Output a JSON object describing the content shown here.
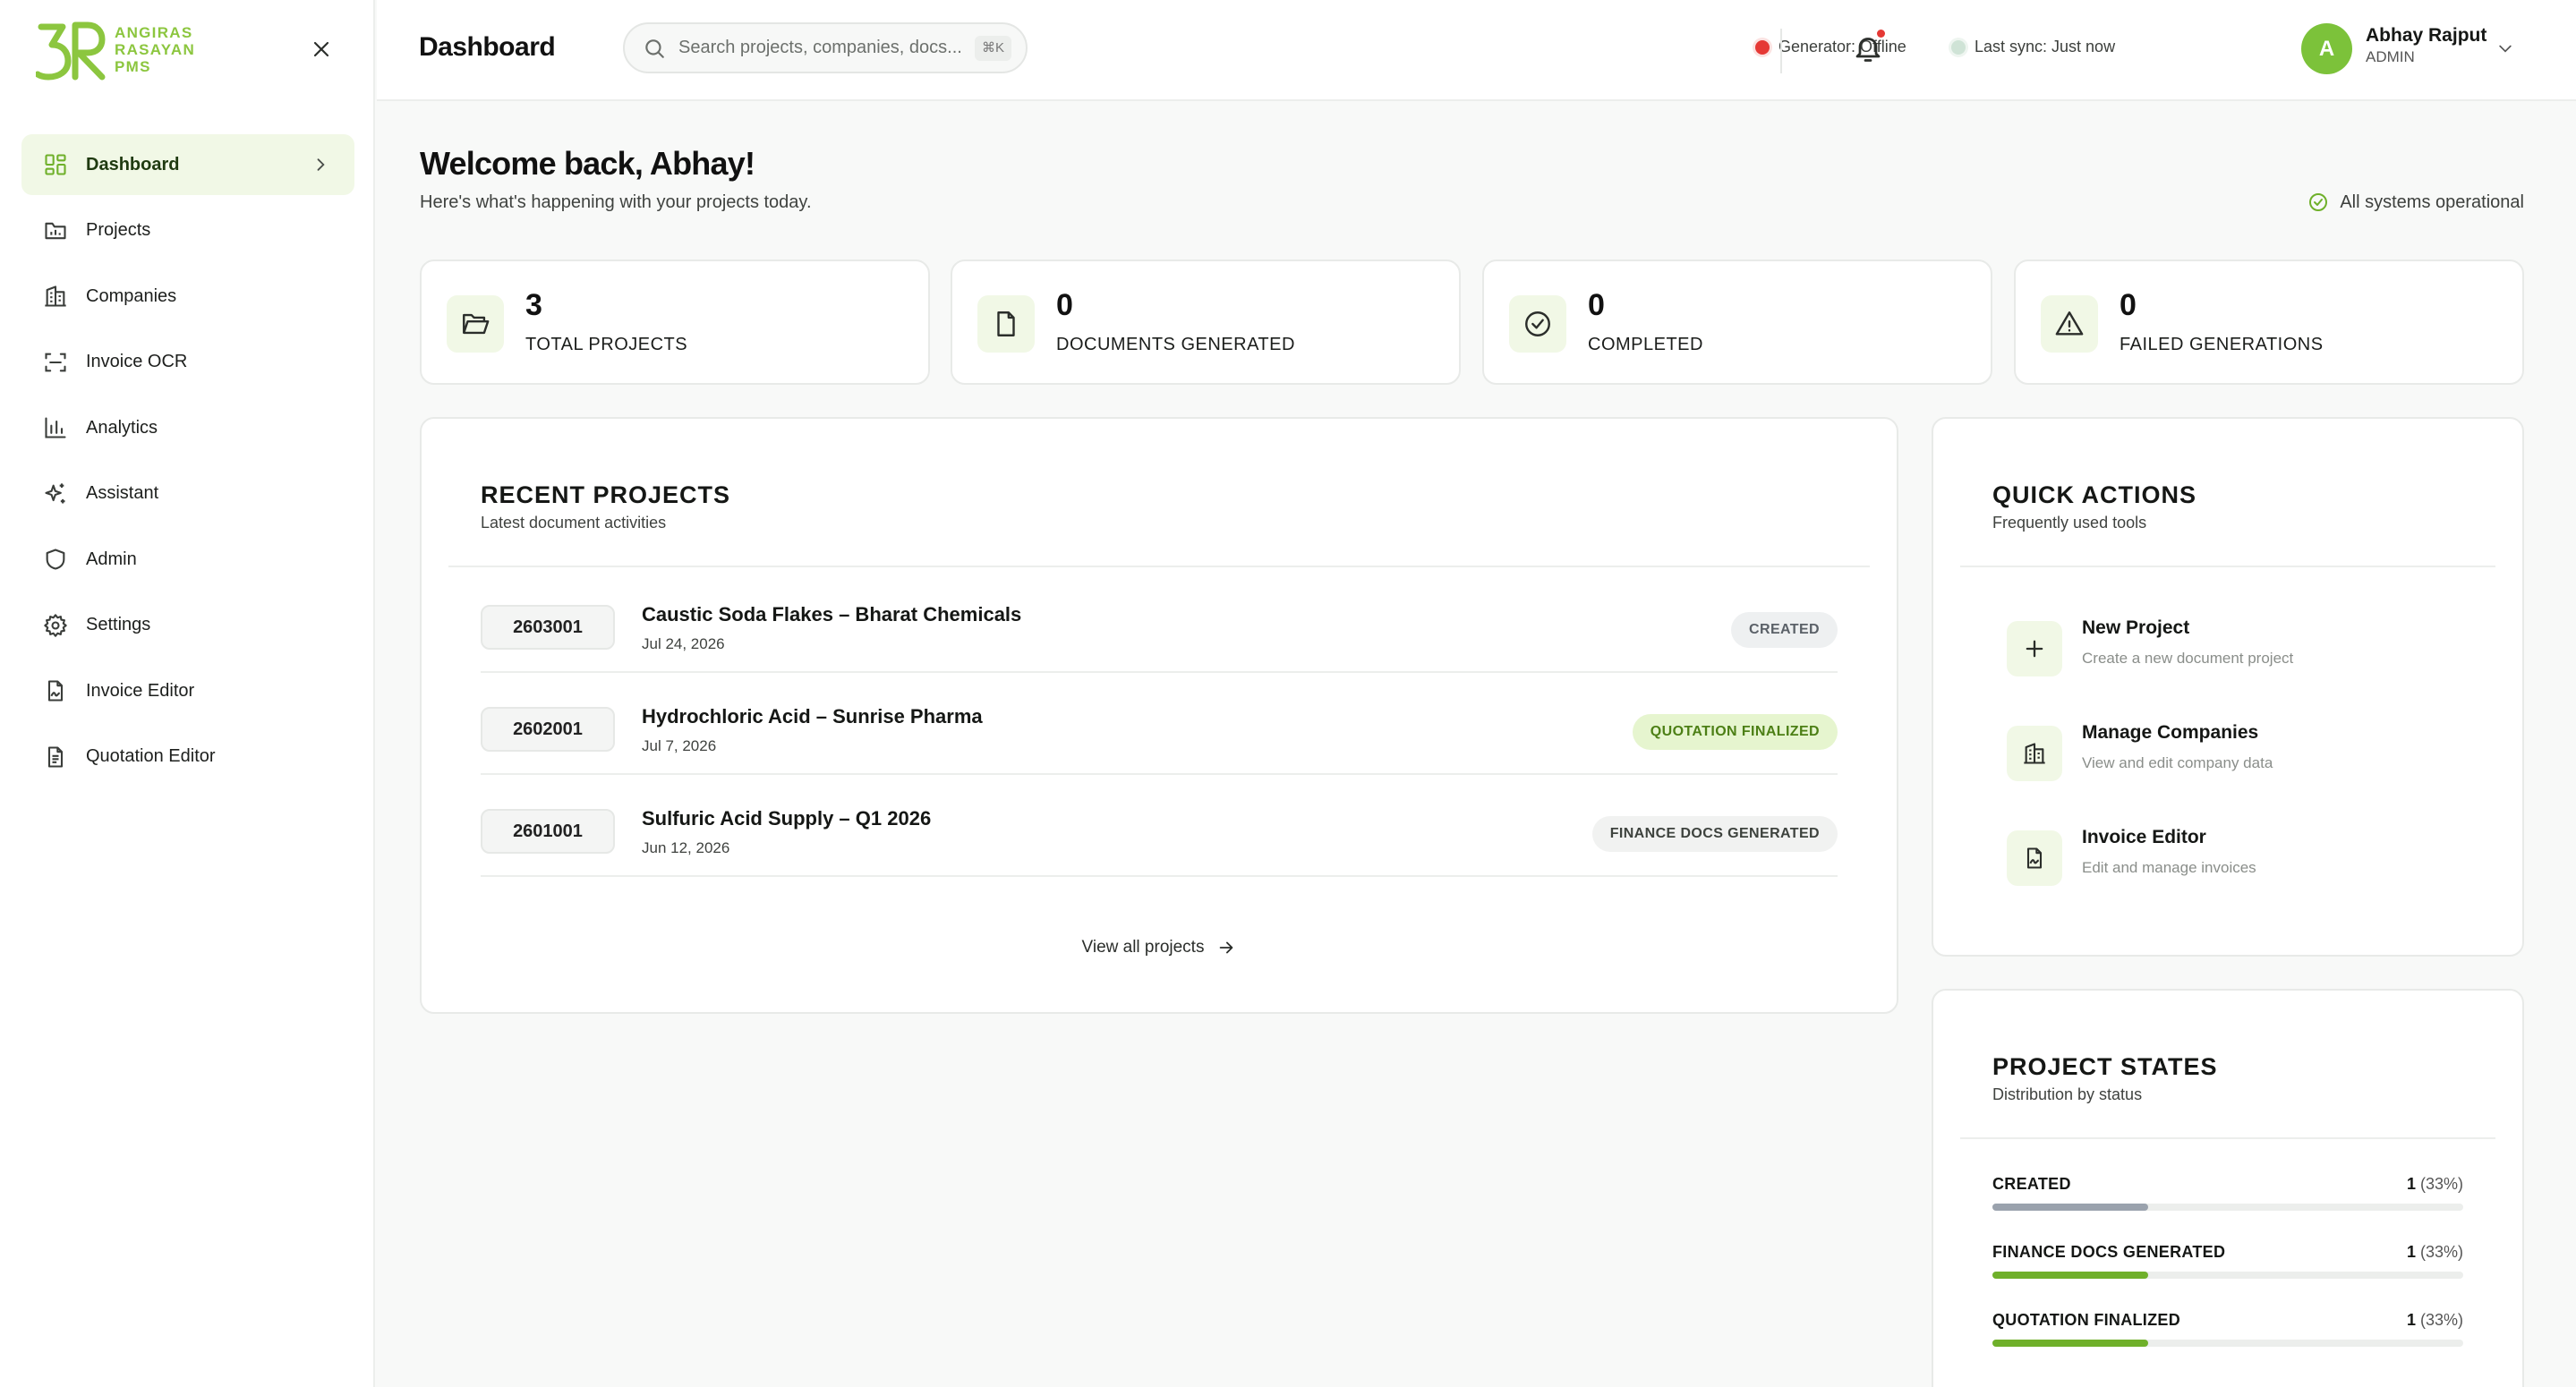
{
  "brand": {
    "logo_lines": [
      "ANGIRAS",
      "RASAYAN",
      "PMS"
    ],
    "accent": "#8cc63f"
  },
  "sidebar": {
    "items": [
      {
        "label": "Dashboard",
        "icon": "dashboard-icon",
        "active": true
      },
      {
        "label": "Projects",
        "icon": "folder-chart-icon"
      },
      {
        "label": "Companies",
        "icon": "building-icon"
      },
      {
        "label": "Invoice OCR",
        "icon": "scan-icon"
      },
      {
        "label": "Analytics",
        "icon": "bar-chart-icon"
      },
      {
        "label": "Assistant",
        "icon": "sparkles-icon"
      },
      {
        "label": "Admin",
        "icon": "shield-icon"
      },
      {
        "label": "Settings",
        "icon": "gear-icon"
      },
      {
        "label": "Invoice Editor",
        "icon": "file-signature-icon"
      },
      {
        "label": "Quotation Editor",
        "icon": "file-text-icon"
      }
    ]
  },
  "header": {
    "title": "Dashboard",
    "search_placeholder": "Search projects, companies, docs...",
    "search_shortcut": "⌘K",
    "generator_status": "Generator: Offline",
    "generator_color": "#e53935",
    "sync_status": "Last sync: Just now",
    "sync_color": "#cfe3d6",
    "user": {
      "initial": "A",
      "name": "Abhay Rajput",
      "role": "ADMIN"
    }
  },
  "welcome": {
    "title": "Welcome back, Abhay!",
    "subtitle": "Here's what's happening with your projects today.",
    "system_status": "All systems operational"
  },
  "stats": [
    {
      "value": "3",
      "label": "TOTAL PROJECTS",
      "icon": "folder-open-icon"
    },
    {
      "value": "0",
      "label": "DOCUMENTS GENERATED",
      "icon": "document-icon"
    },
    {
      "value": "0",
      "label": "COMPLETED",
      "icon": "check-circle-icon"
    },
    {
      "value": "0",
      "label": "FAILED GENERATIONS",
      "icon": "warning-icon"
    }
  ],
  "recent_projects": {
    "title": "RECENT PROJECTS",
    "subtitle": "Latest document activities",
    "items": [
      {
        "code": "2603001",
        "name": "Caustic Soda Flakes – Bharat Chemicals",
        "date": "Jul 24, 2026",
        "status": "CREATED"
      },
      {
        "code": "2602001",
        "name": "Hydrochloric Acid – Sunrise Pharma",
        "date": "Jul 7, 2026",
        "status": "QUOTATION FINALIZED"
      },
      {
        "code": "2601001",
        "name": "Sulfuric Acid Supply – Q1 2026",
        "date": "Jun 12, 2026",
        "status": "FINANCE DOCS GENERATED"
      }
    ],
    "view_all": "View all projects"
  },
  "quick_actions": {
    "title": "QUICK ACTIONS",
    "subtitle": "Frequently used tools",
    "items": [
      {
        "title": "New Project",
        "subtitle": "Create a new document project",
        "icon": "plus-icon"
      },
      {
        "title": "Manage Companies",
        "subtitle": "View and edit company data",
        "icon": "building-icon"
      },
      {
        "title": "Invoice Editor",
        "subtitle": "Edit and manage invoices",
        "icon": "file-signature-icon"
      }
    ]
  },
  "project_states": {
    "title": "PROJECT STATES",
    "subtitle": "Distribution by status",
    "items": [
      {
        "label": "CREATED",
        "count": "1",
        "percent_text": "(33%)",
        "fraction": 0.33,
        "color": "#9aa2ad"
      },
      {
        "label": "FINANCE DOCS GENERATED",
        "count": "1",
        "percent_text": "(33%)",
        "fraction": 0.33,
        "color": "#6fb02a"
      },
      {
        "label": "QUOTATION FINALIZED",
        "count": "1",
        "percent_text": "(33%)",
        "fraction": 0.33,
        "color": "#6fb02a"
      }
    ]
  }
}
